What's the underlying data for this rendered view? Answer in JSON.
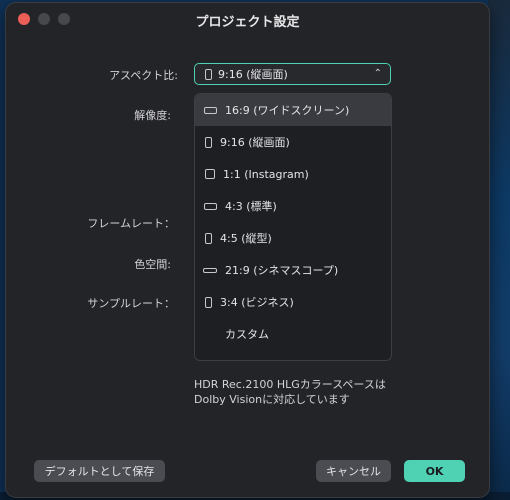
{
  "window": {
    "title": "プロジェクト設定"
  },
  "labels": {
    "aspect": "アスペクト比:",
    "resolution": "解像度:",
    "framerate": "フレームレート：",
    "colorspace": "色空間:",
    "samplerate": "サンプルレート："
  },
  "aspect_select": {
    "value": "9:16 (縦画面)",
    "icon": "portrait-icon"
  },
  "aspect_options": [
    {
      "label": "16:9 (ワイドスクリーン)",
      "icon": "landscape-icon",
      "highlighted": true
    },
    {
      "label": "9:16 (縦画面)",
      "icon": "portrait-icon"
    },
    {
      "label": "1:1 (Instagram)",
      "icon": "square-icon"
    },
    {
      "label": "4:3 (標準)",
      "icon": "landscape-icon"
    },
    {
      "label": "4:5 (縦型)",
      "icon": "portrait-icon"
    },
    {
      "label": "21:9 (シネマスコープ)",
      "icon": "widescreen-icon"
    },
    {
      "label": "3:4 (ビジネス)",
      "icon": "portrait-icon"
    },
    {
      "label": "カスタム",
      "icon": ""
    }
  ],
  "note": {
    "line1": "HDR Rec.2100 HLGカラースペースは",
    "line2": "Dolby Visionに対応しています"
  },
  "buttons": {
    "save_default": "デフォルトとして保存",
    "cancel": "キャンセル",
    "ok": "OK"
  },
  "colors": {
    "accent": "#4fd1b4",
    "close": "#ec5f57"
  }
}
